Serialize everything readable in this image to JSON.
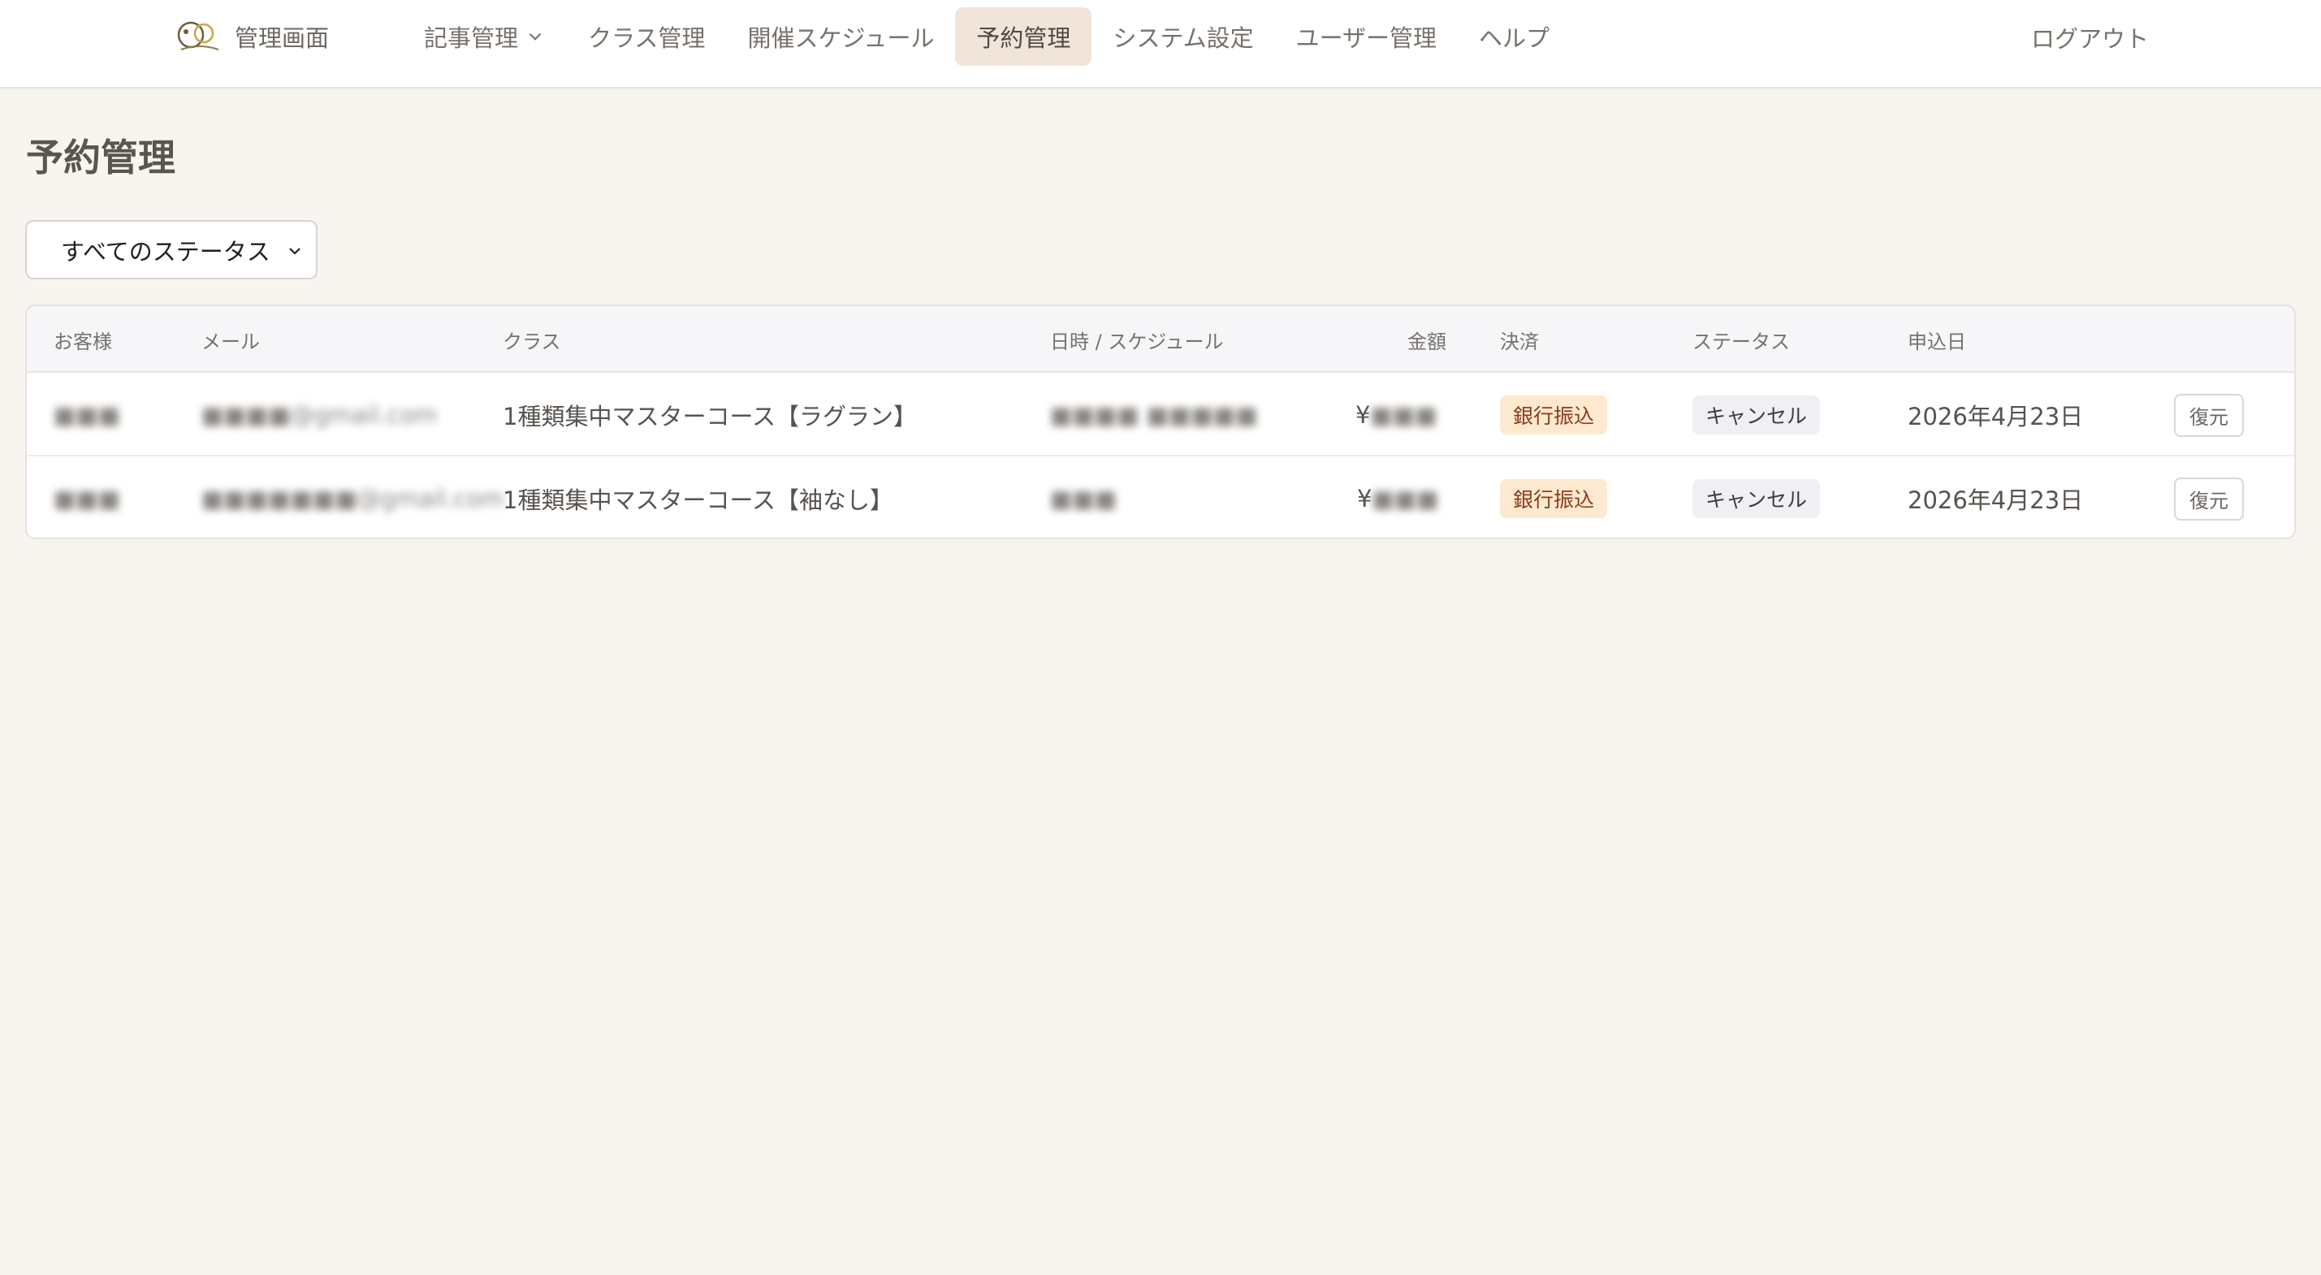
{
  "header": {
    "brand": "管理画面",
    "nav": [
      {
        "label": "記事管理"
      },
      {
        "label": "クラス管理"
      },
      {
        "label": "開催スケジュール"
      },
      {
        "label": "予約管理"
      },
      {
        "label": "システム設定"
      },
      {
        "label": "ユーザー管理"
      },
      {
        "label": "ヘルプ"
      }
    ],
    "logout": "ログアウト"
  },
  "page": {
    "title": "予約管理",
    "filter": {
      "selected": "すべてのステータス"
    }
  },
  "table": {
    "columns": [
      "お客様",
      "メール",
      "クラス",
      "日時 / スケジュール",
      "金額",
      "決済",
      "ステータス",
      "申込日"
    ],
    "rows": [
      {
        "customer": "■■■",
        "email": "■■■■@gmail.com",
        "class": "1種類集中マスターコース【ラグラン】",
        "schedule": "■■■■ ■■■■■",
        "currency": "¥",
        "amount": "■■■",
        "payment": "銀行振込",
        "status": "キャンセル",
        "applied": "2026年4月23日",
        "action": "復元"
      },
      {
        "customer": "■■■",
        "email": "■■■■■■■@gmail.com",
        "class": "1種類集中マスターコース【袖なし】",
        "schedule": "■■■",
        "currency": "¥",
        "amount": "■■■",
        "payment": "銀行振込",
        "status": "キャンセル",
        "applied": "2026年4月23日",
        "action": "復元"
      }
    ]
  },
  "colors": {
    "background": "#f8f5f0",
    "active_nav": "#f1e4d8",
    "payment_badge": "#fde9cf",
    "status_badge": "#eff0f3"
  },
  "icons": {
    "logo": "brand-logo",
    "nav_dropdown": "chevron-down-icon",
    "select_dropdown": "chevron-down-icon"
  }
}
